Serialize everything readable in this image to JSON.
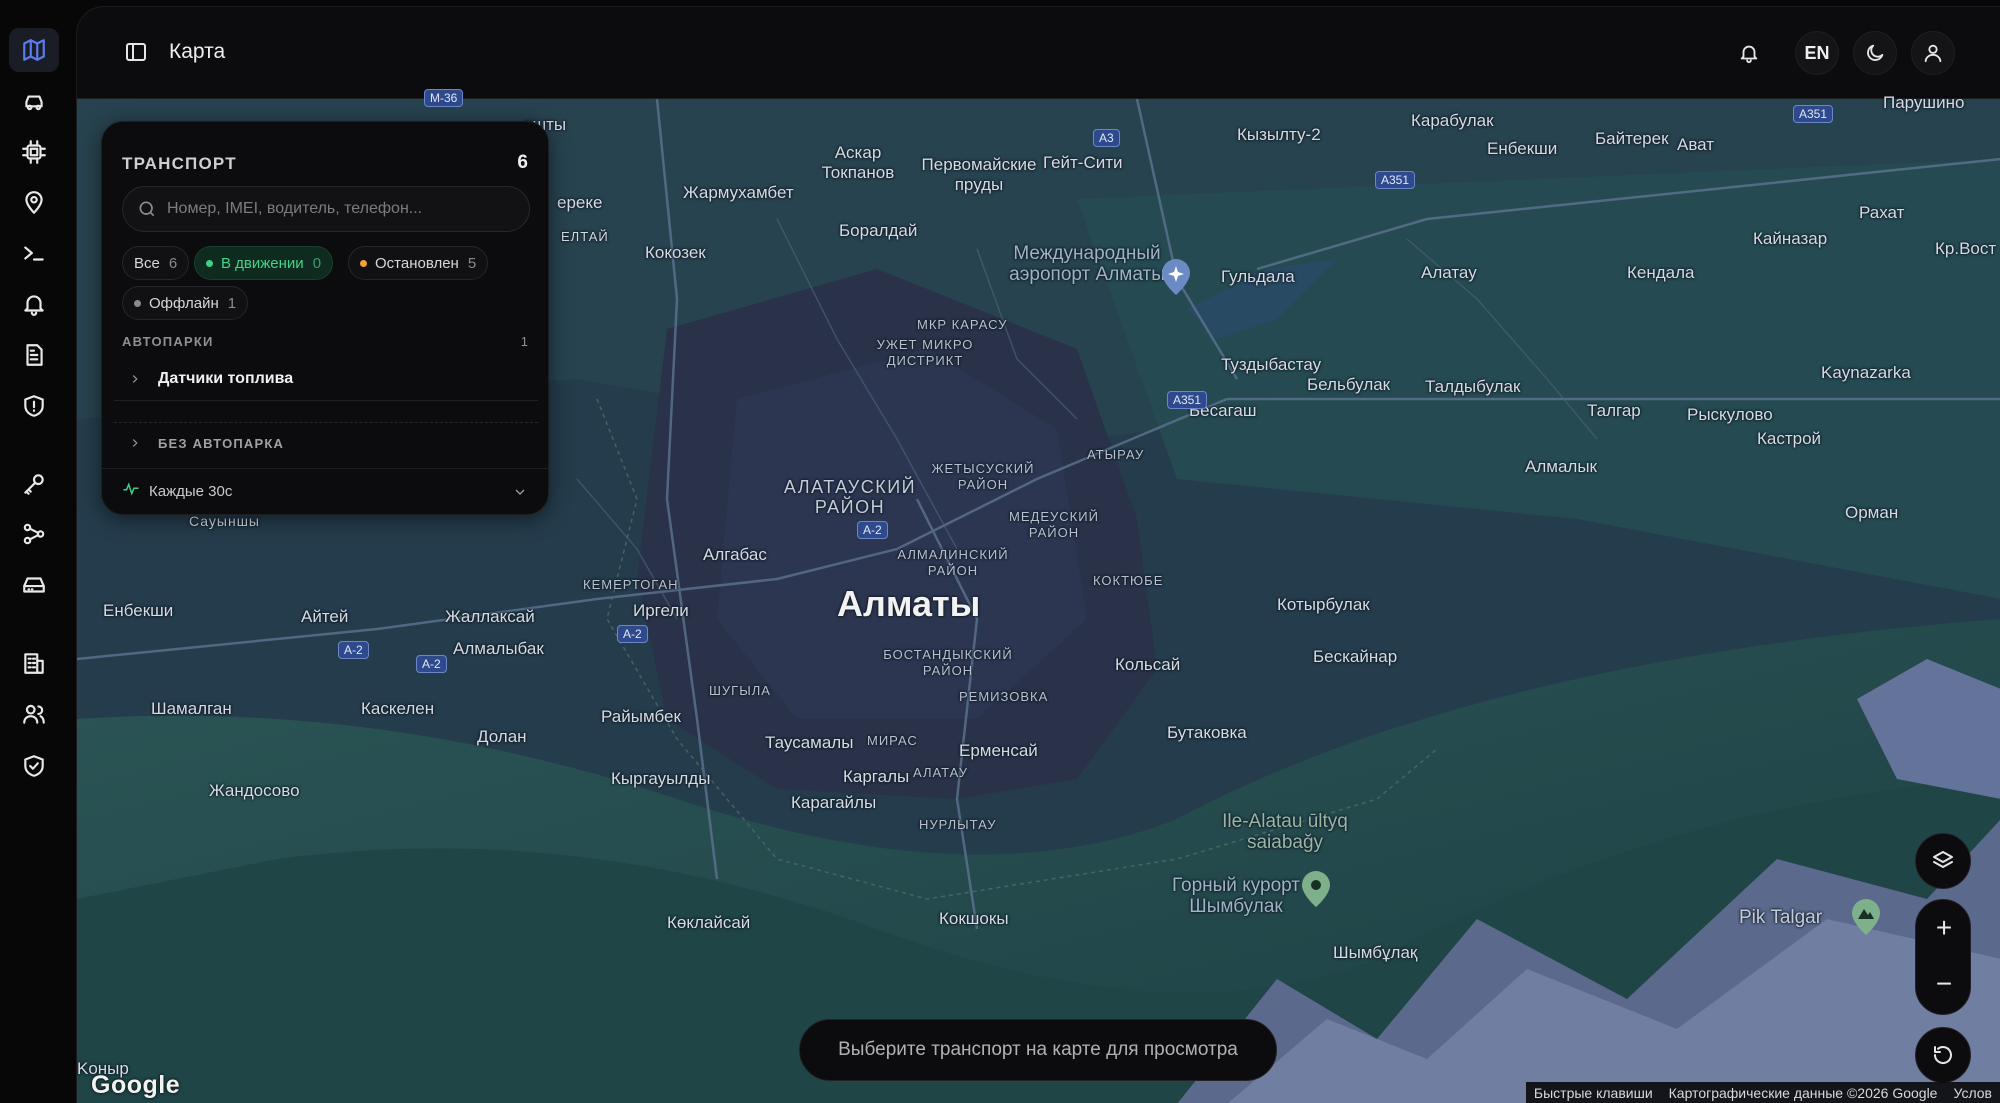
{
  "header": {
    "title": "Карта",
    "lang": "EN"
  },
  "panel": {
    "title": "ТРАНСПОРТ",
    "count": "6",
    "search_placeholder": "Номер, IMEI, водитель, телефон...",
    "filters": [
      {
        "label": "Все",
        "count": "6"
      },
      {
        "label": "В движении",
        "count": "0",
        "color": "#3fcf86"
      },
      {
        "label": "Остановлен",
        "count": "5",
        "color": "#f2a33a"
      },
      {
        "label": "Оффлайн",
        "count": "1",
        "color": "#8a8a92"
      }
    ],
    "fleets_header": "АВТОПАРКИ",
    "fleets_count": "1",
    "fleets": [
      {
        "label": "Датчики топлива"
      }
    ],
    "no_fleet": "БЕЗ АВТОПАРКА",
    "refresh": "Каждые 30с"
  },
  "map": {
    "city": "Алматы",
    "hint": "Выберите транспорт на карте для просмотра",
    "attribution": [
      "Быстрые клавиши",
      "Картографические данные ©2026 Google",
      "Услов"
    ],
    "logo": "Google",
    "labels": {
      "l1": "Карабулак",
      "l2": "Кызылту-2",
      "l3": "Гейт-Сити",
      "l4": "Первомайские пруды",
      "l5": "Аскар Токпанов",
      "l6": "Жармухамбет",
      "l7": "Боралдай",
      "l8": "Кокозек",
      "l9": "Енбекши",
      "l10": "Байтерек",
      "l11": "Ават",
      "l12": "Парушино",
      "l13": "Рахат",
      "l14": "Кайназар",
      "l15": "Кр.Вост",
      "l16": "Кендала",
      "l17": "Алатау",
      "l18": "Гульдала",
      "l19": "Туздыбастау",
      "l20": "Бельбулак",
      "l21": "Талдыбулак",
      "l22": "Бесагаш",
      "l23": "Талгар",
      "l24": "Рыскулово",
      "l25": "Кастрой",
      "l26": "Kaynazarka",
      "l27": "Алмалык",
      "l28": "Орман",
      "l29": "Котырбулак",
      "l30": "Бескайнар",
      "l31": "Кольсай",
      "l32": "Бутаковка",
      "l33": "Ерменсай",
      "l34": "Таусамалы",
      "l35": "Каргалы",
      "l36": "Карагайлы",
      "l37": "Кокшокы",
      "l38": "Шымбұлақ",
      "l39": "Көклайсай",
      "l40": "Кыргауылды",
      "l41": "Жандосово",
      "l42": "Шамалган",
      "l43": "Каскелен",
      "l44": "Долан",
      "l45": "Райымбек",
      "l46": "Иргели",
      "l47": "Алгабас",
      "l48": "Жаллаксай",
      "l49": "Алмалыбак",
      "l50": "Айтей",
      "l51": "Енбекши",
      "l52": "Сауыншы",
      "l53": "ереке",
      "l54": "ашты",
      "l55": "ЕЛТАЙ",
      "l56": "Kоныр",
      "l57": "Pik Talgar",
      "d1": "МКР КАРАСУ",
      "d2": "УЖЕТ МИКРО ДИСТРИКТ",
      "d3": "АТЫРАУ",
      "d4": "ЖЕТЫСУСКИЙ РАЙОН",
      "d5": "МЕДЕУСКИЙ РАЙОН",
      "d6": "АЛМАЛИНСКИЙ РАЙОН",
      "d7": "КОКТЮБЕ",
      "d8": "КЕМЕРТОГАН",
      "d9": "БОСТАНДЫКСКИЙ РАЙОН",
      "d10": "ШУГЫЛА",
      "d11": "РЕМИЗОВКА",
      "d12": "МИРАС",
      "d13": "АЛАТАУ",
      "d14": "НУРЛЫТАУ",
      "big1": "АЛАТАУСКИЙ РАЙОН",
      "p1": "Международный аэропорт Алматы",
      "p2": "Ile-Alatau ūltyq saiabağy",
      "p3": "Горный курорт Шымбулак"
    },
    "shields": [
      "A3",
      "A351",
      "A351",
      "A351",
      "A-2",
      "A-2",
      "A-2",
      "A-2",
      "M-36"
    ]
  }
}
